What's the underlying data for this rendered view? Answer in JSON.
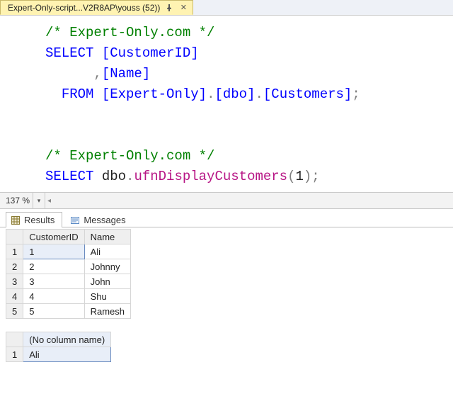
{
  "tab": {
    "title": "Expert-Only-script...V2R8AP\\youss (52))"
  },
  "editor": {
    "line1_comment": "/* Expert-Only.com */",
    "line2_kw": "SELECT",
    "line2_col": "[CustomerID]",
    "line3_comma": ",",
    "line3_col": "[Name]",
    "line4_kw": "FROM",
    "line4_db": "[Expert-Only]",
    "line4_dot1": ".",
    "line4_schema": "[dbo]",
    "line4_dot2": ".",
    "line4_tbl": "[Customers]",
    "line4_semi": ";",
    "line7_comment": "/* Expert-Only.com */",
    "line8_kw": "SELECT",
    "line8_fn_pre": " dbo",
    "line8_fn_dot": ".",
    "line8_fn_name": "ufnDisplayCustomers",
    "line8_fn_paren_open": "(",
    "line8_fn_arg": "1",
    "line8_fn_paren_close": ")",
    "line8_semi": ";"
  },
  "zoom": {
    "pct": "137 %"
  },
  "resultTabs": {
    "results": "Results",
    "messages": "Messages"
  },
  "grid1": {
    "headers": [
      "CustomerID",
      "Name"
    ],
    "rows": [
      {
        "n": "1",
        "cells": [
          "1",
          "Ali"
        ]
      },
      {
        "n": "2",
        "cells": [
          "2",
          "Johnny"
        ]
      },
      {
        "n": "3",
        "cells": [
          "3",
          "John"
        ]
      },
      {
        "n": "4",
        "cells": [
          "4",
          "Shu"
        ]
      },
      {
        "n": "5",
        "cells": [
          "5",
          "Ramesh"
        ]
      }
    ]
  },
  "grid2": {
    "headers": [
      "(No column name)"
    ],
    "rows": [
      {
        "n": "1",
        "cells": [
          "Ali"
        ]
      }
    ]
  }
}
